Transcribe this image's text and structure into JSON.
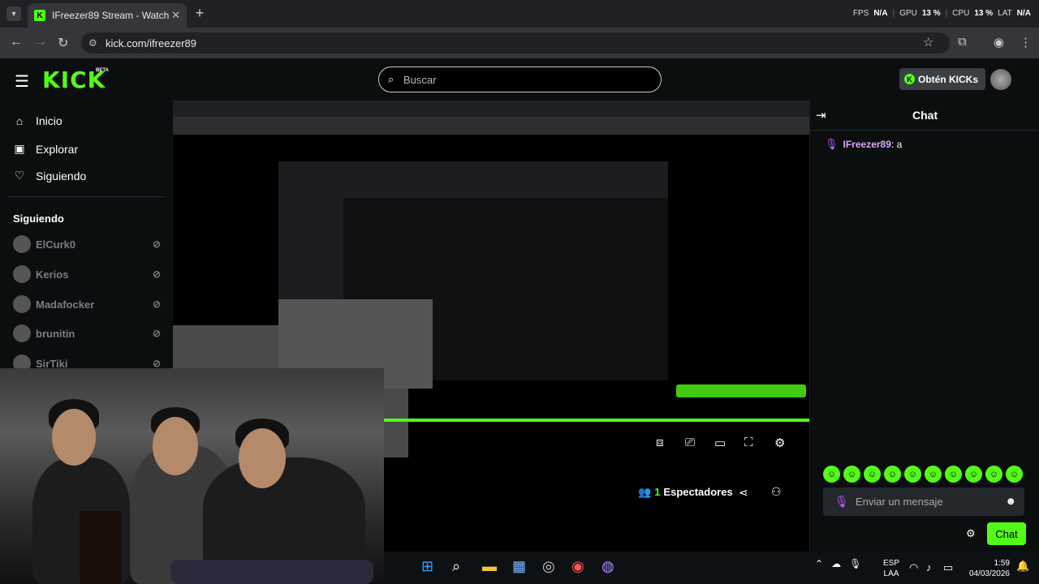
{
  "browser": {
    "tab_title": "IFreezer89 Stream - Watch Live",
    "url": "kick.com/ifreezer89",
    "stats": {
      "fps_label": "FPS",
      "fps": "N/A",
      "gpu_label": "GPU",
      "gpu": "13 %",
      "cpu_label": "CPU",
      "cpu": "13 %",
      "lat_label": "LAT",
      "lat": "N/A"
    }
  },
  "header": {
    "logo": "KICK",
    "beta": "BETA",
    "search_placeholder": "Buscar",
    "kicks_button": "Obtén KICKs"
  },
  "sidebar": {
    "nav": [
      {
        "label": "Inicio",
        "icon": "home-icon"
      },
      {
        "label": "Explorar",
        "icon": "compass-icon"
      },
      {
        "label": "Siguiendo",
        "icon": "heart-icon"
      }
    ],
    "following_heading": "Siguiendo",
    "following": [
      {
        "name": "ElCurk0",
        "status": "offline"
      },
      {
        "name": "Kerios",
        "status": "offline"
      },
      {
        "name": "Madafocker",
        "status": "offline"
      },
      {
        "name": "brunitin",
        "status": "offline"
      },
      {
        "name": "SirTiki",
        "status": "offline"
      }
    ]
  },
  "stream": {
    "viewers_count": "1",
    "viewers_label": "Espectadores"
  },
  "chat": {
    "title": "Chat",
    "messages": [
      {
        "user": "IFreezer89",
        "text": "a"
      }
    ],
    "input_placeholder": "Enviar un mensaje",
    "send_button": "Chat",
    "accent": "#53fc18"
  },
  "taskbar": {
    "lang_line1": "ESP",
    "lang_line2": "LAA",
    "time": "1:59",
    "date": "04/03/2026"
  }
}
